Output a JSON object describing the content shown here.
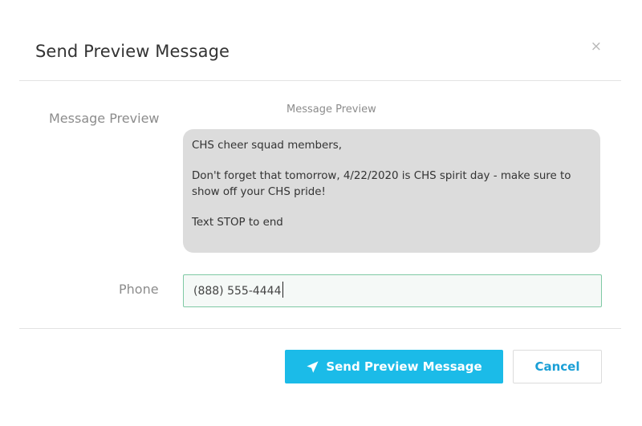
{
  "dialog": {
    "title": "Send Preview Message",
    "close_icon": "close-icon",
    "close_glyph": "×"
  },
  "preview": {
    "label": "Message Preview",
    "caption": "Message Preview",
    "message": {
      "line1": "CHS cheer squad members,",
      "line2": "Don't forget that tomorrow, 4/22/2020 is CHS spirit day - make sure to show off your CHS pride!",
      "line3": "Text STOP to end"
    },
    "bubble_color": "#dcdcdc"
  },
  "phone": {
    "label": "Phone",
    "value": "(888) 555-4444",
    "border_color": "#7fc9a4"
  },
  "actions": {
    "send_label": "Send Preview Message",
    "send_icon": "paper-plane-icon",
    "cancel_label": "Cancel",
    "accent_color": "#1bbbe8",
    "link_color": "#1a9fd6"
  }
}
